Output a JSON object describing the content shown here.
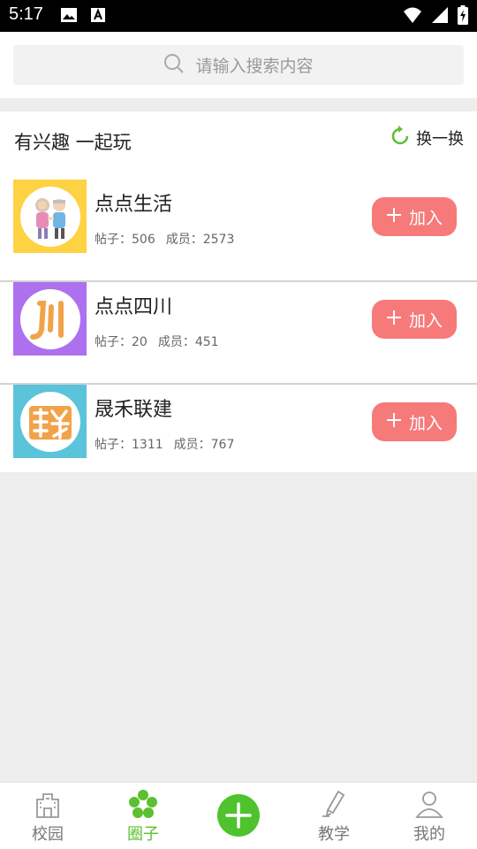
{
  "status_bar": {
    "time": "5:17"
  },
  "search": {
    "placeholder": "请输入搜索内容"
  },
  "section": {
    "title": "有兴趣  一起玩",
    "refresh_label": "换一换"
  },
  "groups": [
    {
      "name": "点点生活",
      "posts_label": "帖子：",
      "posts": "506",
      "members_label": "成员：",
      "members": "2573",
      "join_label": "加入",
      "thumb_color": "#fed243"
    },
    {
      "name": "点点四川",
      "posts_label": "帖子：",
      "posts": "20",
      "members_label": "成员：",
      "members": "451",
      "join_label": "加入",
      "thumb_color": "#ad71ef"
    },
    {
      "name": "晟禾联建",
      "posts_label": "帖子：",
      "posts": "1311",
      "members_label": "成员：",
      "members": "767",
      "join_label": "加入",
      "thumb_color": "#5bc3da"
    }
  ],
  "tabs": [
    {
      "label": "校园",
      "icon": "campus-icon",
      "active": false
    },
    {
      "label": "圈子",
      "icon": "circle-icon",
      "active": true
    },
    {
      "label": "",
      "icon": "add-icon",
      "active": false
    },
    {
      "label": "教学",
      "icon": "teach-icon",
      "active": false
    },
    {
      "label": "我的",
      "icon": "profile-icon",
      "active": false
    }
  ],
  "colors": {
    "accent_green": "#5cc030",
    "join_button": "#f67a7a",
    "background": "#ededed"
  }
}
